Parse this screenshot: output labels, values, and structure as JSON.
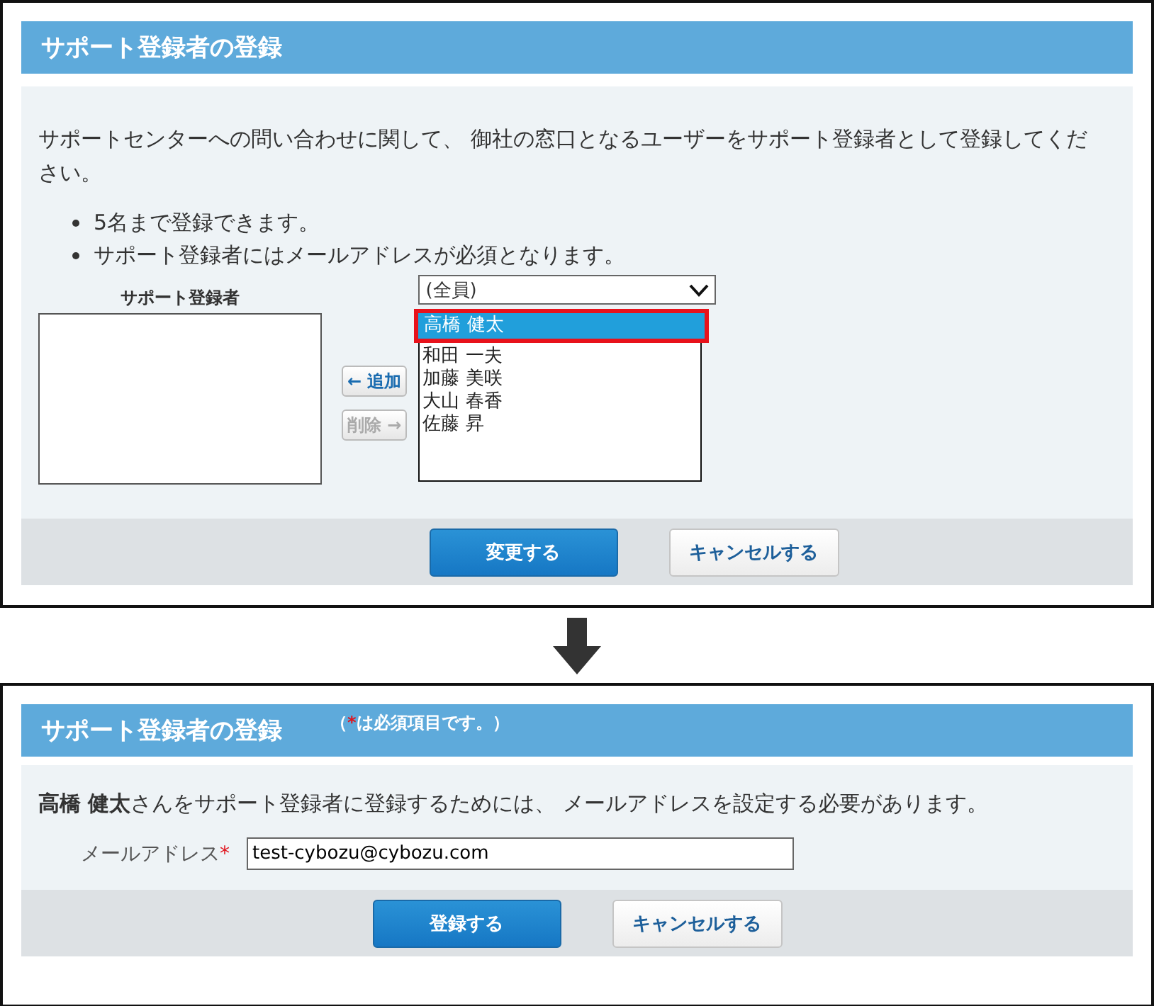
{
  "panels": [
    {
      "title": "サポート登録者の登録",
      "intro": "サポートセンターへの問い合わせに関して、 御社の窓口となるユーザーをサポート登録者として登録してください。",
      "bullets": [
        "5名まで登録できます。",
        "サポート登録者にはメールアドレスが必須となります。"
      ],
      "selected_list": {
        "label": "サポート登録者"
      },
      "add_button": {
        "label": "← 追加",
        "disabled": false
      },
      "remove_button": {
        "label": "削除 →",
        "disabled": true
      },
      "group_dropdown": {
        "value": "(全員)"
      },
      "user_list": [
        {
          "name": "高橋 健太",
          "selected": true,
          "highlighted": true
        },
        {
          "name": "和田 一夫",
          "selected": false,
          "highlighted": false
        },
        {
          "name": "加藤 美咲",
          "selected": false,
          "highlighted": false
        },
        {
          "name": "大山 春香",
          "selected": false,
          "highlighted": false
        },
        {
          "name": "佐藤 昇",
          "selected": false,
          "highlighted": false
        }
      ],
      "buttons": [
        {
          "label": "変更する",
          "kind": "primary"
        },
        {
          "label": "キャンセルする",
          "kind": "secondary"
        }
      ]
    },
    {
      "title": "サポート登録者の登録",
      "note": {
        "open": "（",
        "mark": "*",
        "text": "は必須項目です。）"
      },
      "message": "**高橋 健太**さんをサポート登録者に登録するためには、 メールアドレスを設定する必要があります。",
      "email_field": {
        "label": "メールアドレス",
        "required": true,
        "value": "test-cybozu@cybozu.com"
      },
      "buttons": [
        {
          "label": "登録する",
          "kind": "primary"
        },
        {
          "label": "キャンセルする",
          "kind": "secondary"
        }
      ]
    }
  ]
}
